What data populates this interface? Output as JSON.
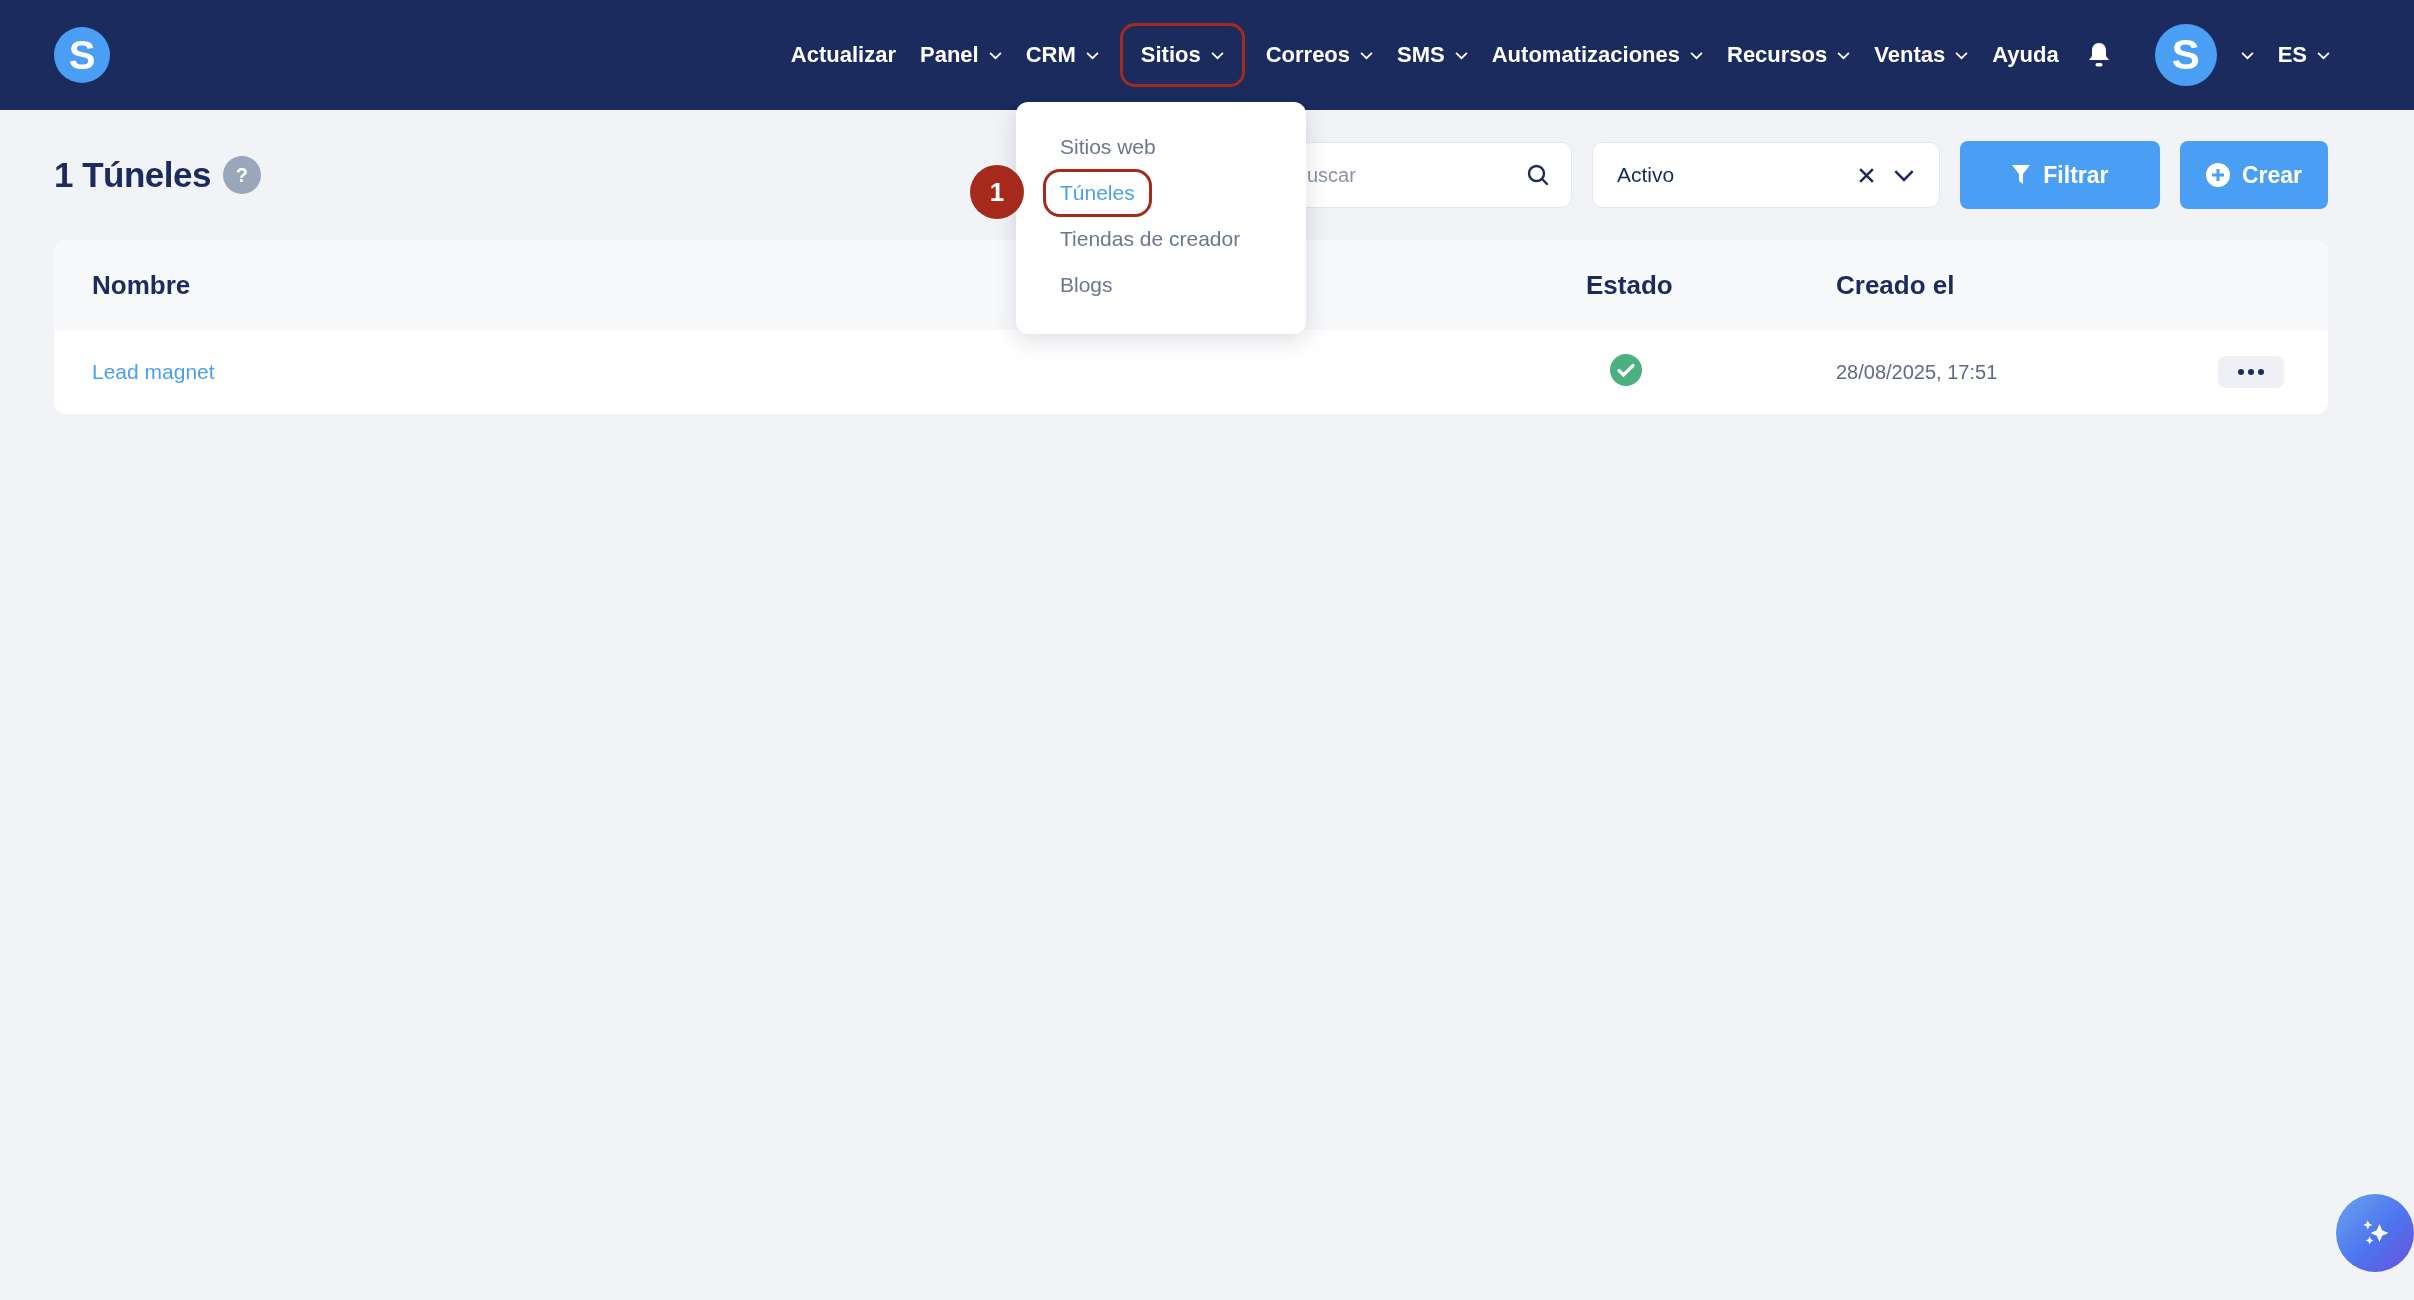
{
  "navbar": {
    "logo": "S",
    "items": [
      {
        "label": "Actualizar",
        "caret": false,
        "highlighted": false
      },
      {
        "label": "Panel",
        "caret": true,
        "highlighted": false
      },
      {
        "label": "CRM",
        "caret": true,
        "highlighted": false
      },
      {
        "label": "Sitios",
        "caret": true,
        "highlighted": true
      },
      {
        "label": "Correos",
        "caret": true,
        "highlighted": false
      },
      {
        "label": "SMS",
        "caret": true,
        "highlighted": false
      },
      {
        "label": "Automatizaciones",
        "caret": true,
        "highlighted": false
      },
      {
        "label": "Recursos",
        "caret": true,
        "highlighted": false
      },
      {
        "label": "Ventas",
        "caret": true,
        "highlighted": false
      },
      {
        "label": "Ayuda",
        "caret": false,
        "highlighted": false
      }
    ],
    "avatar": "S",
    "language": "ES"
  },
  "dropdown": {
    "items": [
      {
        "label": "Sitios web",
        "selected": false,
        "highlighted": false
      },
      {
        "label": "Túneles",
        "selected": true,
        "highlighted": true
      },
      {
        "label": "Tiendas de creador",
        "selected": false,
        "highlighted": false
      },
      {
        "label": "Blogs",
        "selected": false,
        "highlighted": false
      }
    ],
    "step_badge": "1"
  },
  "page": {
    "title": "1 Túneles",
    "help": "?"
  },
  "toolbar": {
    "search": {
      "placeholder": "uscar"
    },
    "status_filter": {
      "value": "Activo"
    },
    "buttons": [
      "Filtrar",
      "Crear"
    ]
  },
  "table": {
    "columns": [
      "Nombre",
      "Estado",
      "Creado el"
    ],
    "rows": [
      {
        "name": "Lead magnet",
        "active": true,
        "created": "28/08/2025, 17:51"
      }
    ]
  }
}
